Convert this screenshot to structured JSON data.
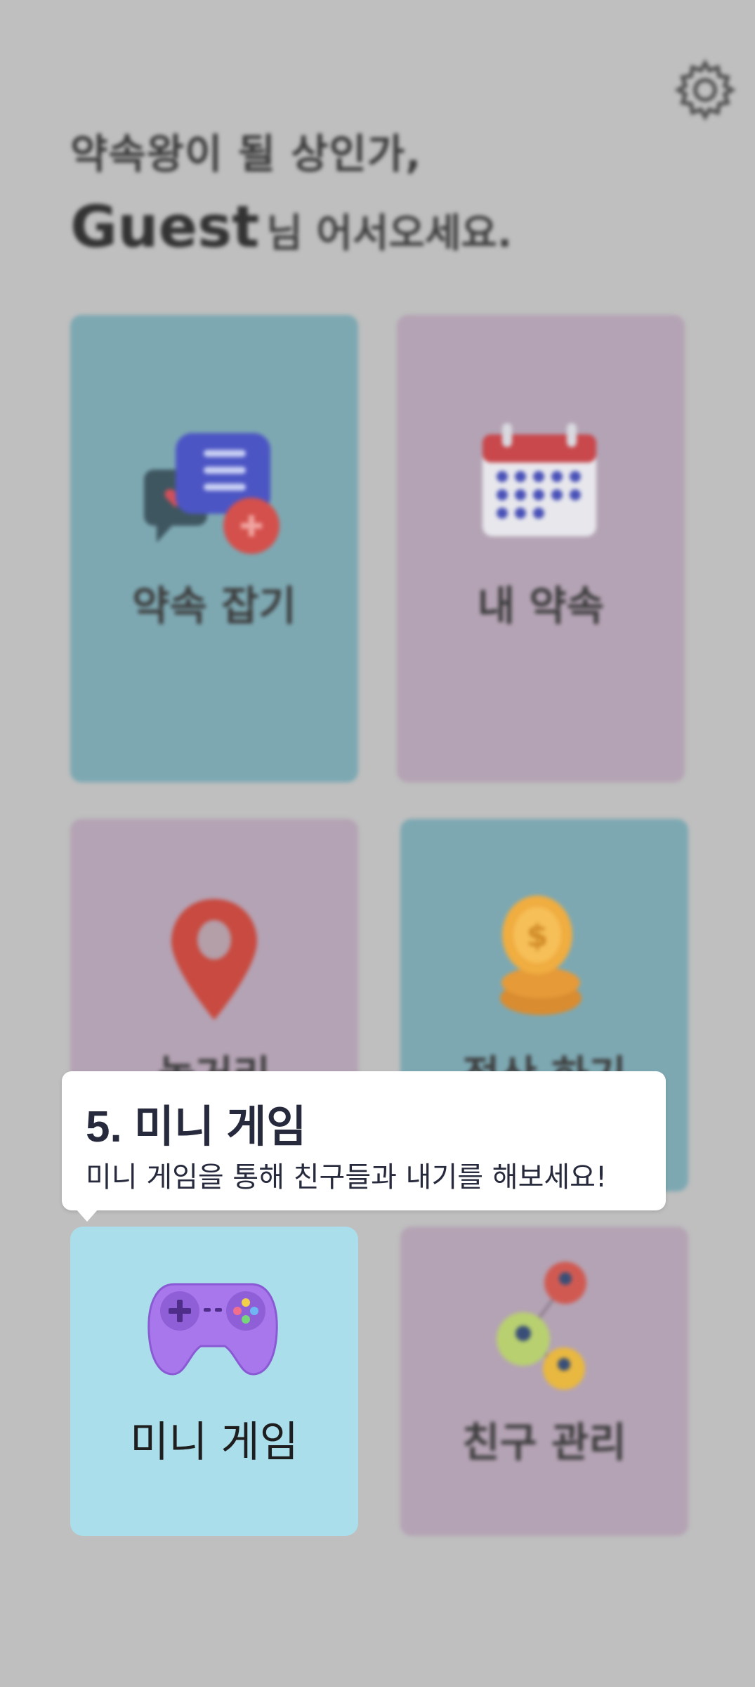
{
  "header": {
    "greeting_line1": "약속왕이 될 상인가,",
    "user_name": "Guest",
    "greeting_suffix": "님 어서오세요."
  },
  "menu": {
    "make_appointment": "약속 잡기",
    "my_appointments": "내 약속",
    "location": "놀거리",
    "settle_up": "정산 하기",
    "mini_game": "미니 게임",
    "friends": "친구 관리"
  },
  "tutorial": {
    "title": "5. 미니 게임",
    "description": "미니 게임을 통해 친구들과 내기를 해보세요!"
  },
  "icons": {
    "settings": "gear-icon",
    "make_appointment": "chat-plus-icon",
    "my_appointments": "calendar-icon",
    "location": "location-pin-icon",
    "settle_up": "coin-stack-icon",
    "mini_game": "gamepad-icon",
    "friends": "friends-network-icon"
  },
  "colors": {
    "overlay_background": "#bfbfbf",
    "teal_card": "#7da8b2",
    "mauve_card": "#b4a3b4",
    "highlight_card": "#aadeea",
    "tooltip_text": "#262a3c"
  }
}
